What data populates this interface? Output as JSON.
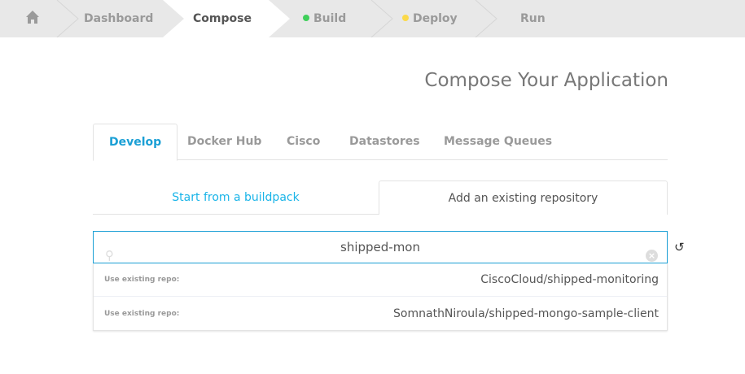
{
  "breadcrumb": {
    "items": [
      {
        "label": "Dashboard"
      },
      {
        "label": "Compose",
        "active": true
      },
      {
        "label": "Build",
        "status_color": "#3fcf5a"
      },
      {
        "label": "Deploy",
        "status_color": "#fbd94a"
      },
      {
        "label": "Run"
      }
    ]
  },
  "page_title": "Compose Your Application",
  "tabs": [
    {
      "label": "Develop"
    },
    {
      "label": "Docker Hub"
    },
    {
      "label": "Cisco"
    },
    {
      "label": "Datastores"
    },
    {
      "label": "Message Queues"
    }
  ],
  "subtabs": {
    "buildpack": "Start from a buildpack",
    "existing": "Add an existing repository"
  },
  "search": {
    "value": "shipped-mon"
  },
  "results": [
    {
      "label": "Use existing repo:",
      "repo": "CiscoCloud/shipped-monitoring"
    },
    {
      "label": "Use existing repo:",
      "repo": "SomnathNiroula/shipped-mongo-sample-client"
    }
  ],
  "colors": {
    "accent": "#1a9fd5",
    "link": "#19b4e8"
  }
}
